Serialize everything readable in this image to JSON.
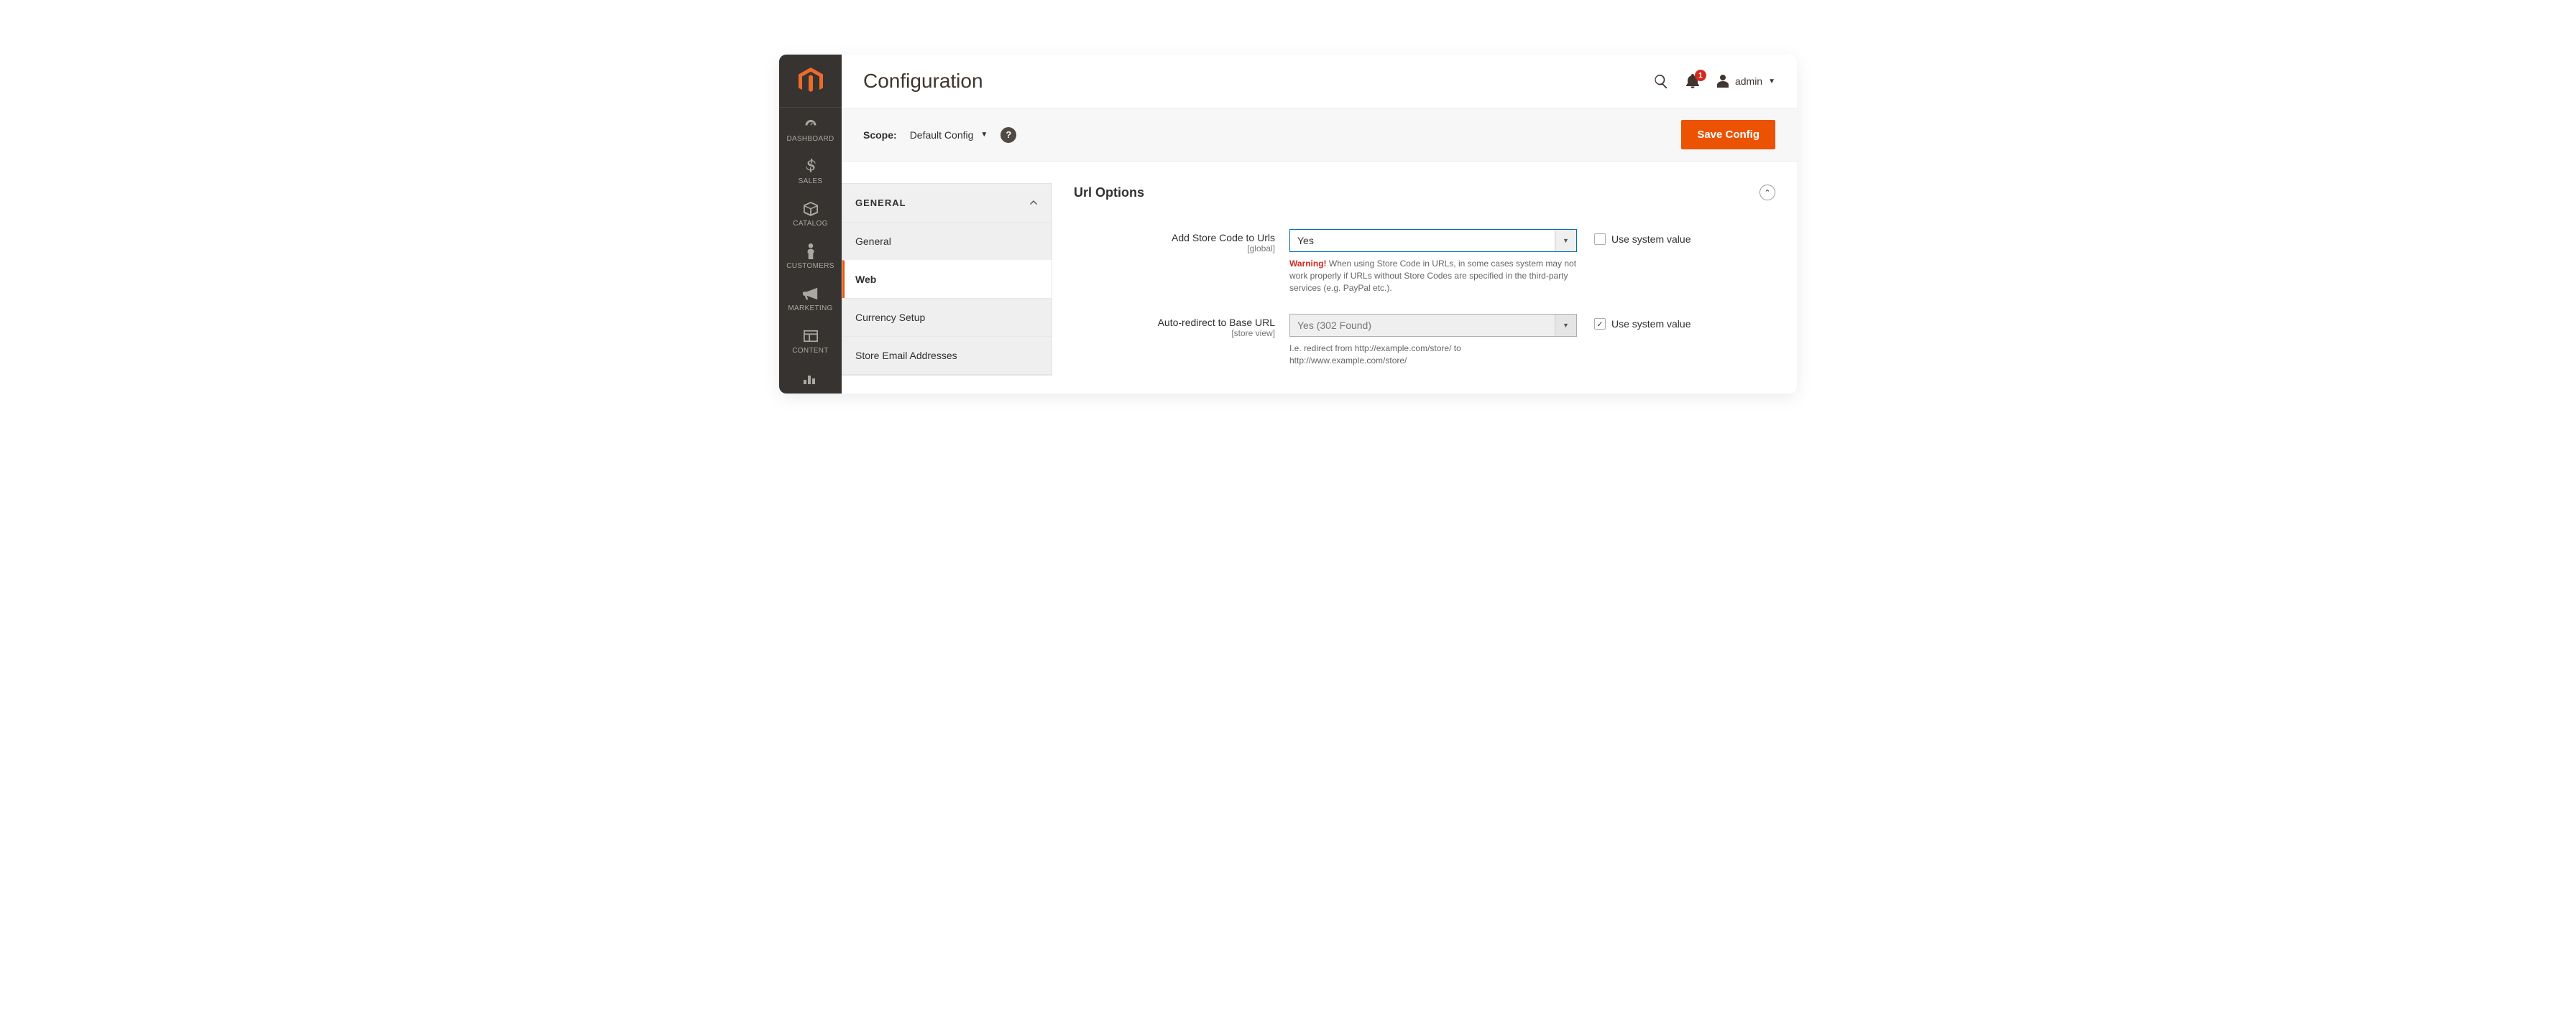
{
  "header": {
    "title": "Configuration",
    "notif_count": "1",
    "user": "admin"
  },
  "scope": {
    "label": "Scope:",
    "value": "Default Config",
    "save_btn": "Save Config"
  },
  "sidebar": {
    "items": [
      {
        "label": "DASHBOARD"
      },
      {
        "label": "SALES"
      },
      {
        "label": "CATALOG"
      },
      {
        "label": "CUSTOMERS"
      },
      {
        "label": "MARKETING"
      },
      {
        "label": "CONTENT"
      }
    ]
  },
  "confignav": {
    "group": "GENERAL",
    "items": [
      {
        "label": "General"
      },
      {
        "label": "Web"
      },
      {
        "label": "Currency Setup"
      },
      {
        "label": "Store Email Addresses"
      }
    ]
  },
  "settings": {
    "section_title": "Url Options",
    "fields": [
      {
        "label": "Add Store Code to Urls",
        "scope": "[global]",
        "value": "Yes",
        "use_system": false,
        "use_system_label": "Use system value",
        "note_warn": "Warning!",
        "note": " When using Store Code in URLs, in some cases system may not work properly if URLs without Store Codes are specified in the third-party services (e.g. PayPal etc.)."
      },
      {
        "label": "Auto-redirect to Base URL",
        "scope": "[store view]",
        "value": "Yes (302 Found)",
        "use_system": true,
        "use_system_label": "Use system value",
        "note": "I.e. redirect from http://example.com/store/ to http://www.example.com/store/"
      }
    ]
  }
}
